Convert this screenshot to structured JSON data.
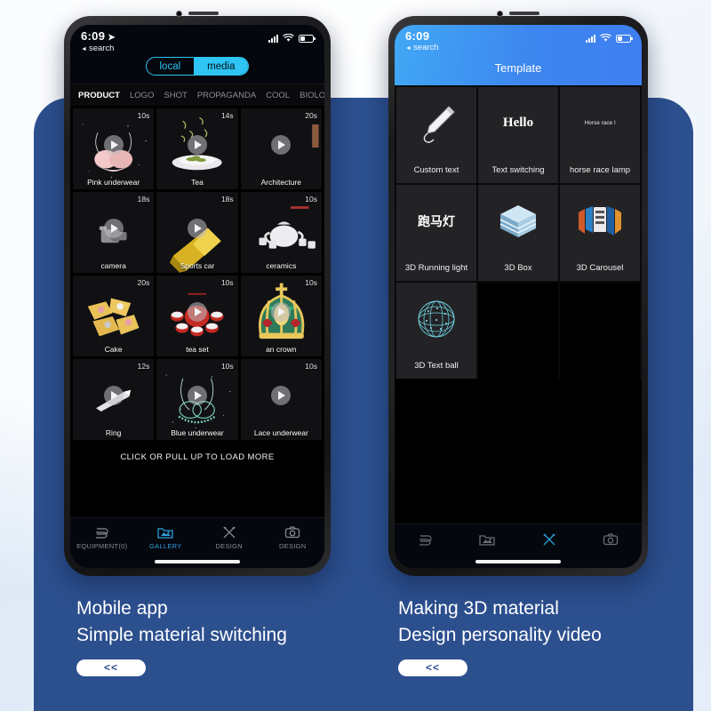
{
  "theme": {
    "bg_light": "#dfeaf7",
    "panel_blue": "#2c4f8e",
    "accent_cyan": "#2ec4f3",
    "accent_blue": "#2e9fd6",
    "header_blue": "#3d86ef"
  },
  "left_phone": {
    "status": {
      "time": "6:09",
      "location_arrow": "➤",
      "back_label": "search",
      "back_arrow": "◄",
      "signal_icon": "signal-bars-icon",
      "wifi_icon": "wifi-icon",
      "battery_icon": "battery-icon"
    },
    "segment": {
      "options": [
        "local",
        "media"
      ],
      "selected": "media"
    },
    "categories": [
      "PRODUCT",
      "LOGO",
      "SHOT",
      "PROPAGANDA",
      "COOL",
      "BIOLOGY"
    ],
    "active_category": "PRODUCT",
    "gallery": [
      {
        "caption": "Pink underwear",
        "duration": "10s",
        "art": "pink-underwear",
        "play": true
      },
      {
        "caption": "Tea",
        "duration": "14s",
        "art": "tea-plate",
        "play": true
      },
      {
        "caption": "Architecture",
        "duration": "20s",
        "art": "architecture",
        "play": true
      },
      {
        "caption": "camera",
        "duration": "18s",
        "art": "camera",
        "play": true
      },
      {
        "caption": "Sports car",
        "duration": "18s",
        "art": "sports-car",
        "play": true
      },
      {
        "caption": "ceramics",
        "duration": "10s",
        "art": "ceramics",
        "play": false
      },
      {
        "caption": "Cake",
        "duration": "20s",
        "art": "cake",
        "play": false
      },
      {
        "caption": "tea set",
        "duration": "10s",
        "art": "tea-set",
        "play": true
      },
      {
        "caption": "an crown",
        "duration": "10s",
        "art": "crown",
        "play": true
      },
      {
        "caption": "Ring",
        "duration": "12s",
        "art": "ring",
        "play": true
      },
      {
        "caption": "Blue underwear",
        "duration": "10s",
        "art": "blue-underwear",
        "play": true
      },
      {
        "caption": "Lace underwear",
        "duration": "10s",
        "art": "lace-underwear",
        "play": true
      }
    ],
    "load_more": "CLICK OR PULL UP TO LOAD MORE",
    "tabbar": [
      {
        "label": "EQUIPMENT(0)",
        "icon": "equipment-icon",
        "active": false
      },
      {
        "label": "GALLERY",
        "icon": "gallery-icon",
        "active": true
      },
      {
        "label": "DESIGN",
        "icon": "design-icon",
        "active": false
      },
      {
        "label": "DESIGN",
        "icon": "camera-icon",
        "active": false
      }
    ]
  },
  "right_phone": {
    "status": {
      "time": "6:09",
      "back_label": "search",
      "back_arrow": "◄",
      "signal_icon": "signal-bars-icon",
      "wifi_icon": "wifi-icon",
      "battery_icon": "battery-icon"
    },
    "title": "Template",
    "templates": [
      {
        "caption": "Custom text",
        "art": "pencil"
      },
      {
        "caption": "Text switching",
        "art": "hello-text",
        "art_text": "Hello"
      },
      {
        "caption": "horse race lamp",
        "art": "marquee-text",
        "art_text": "Horse race l"
      },
      {
        "caption": "3D Running light",
        "art": "cn-text",
        "art_text": "跑马灯"
      },
      {
        "caption": "3D Box",
        "art": "cube"
      },
      {
        "caption": "3D Carousel",
        "art": "carousel"
      },
      {
        "caption": "3D Text ball",
        "art": "text-ball"
      }
    ],
    "tabbar": [
      {
        "icon": "equipment-icon",
        "active": false
      },
      {
        "icon": "gallery-icon",
        "active": false
      },
      {
        "icon": "design-icon",
        "active": true
      },
      {
        "icon": "camera-icon",
        "active": false
      }
    ]
  },
  "captions": {
    "left": {
      "line1": "Mobile app",
      "line2": "Simple material switching",
      "button": "<<"
    },
    "right": {
      "line1": "Making 3D material",
      "line2": "Design personality video",
      "button": "<<"
    }
  }
}
